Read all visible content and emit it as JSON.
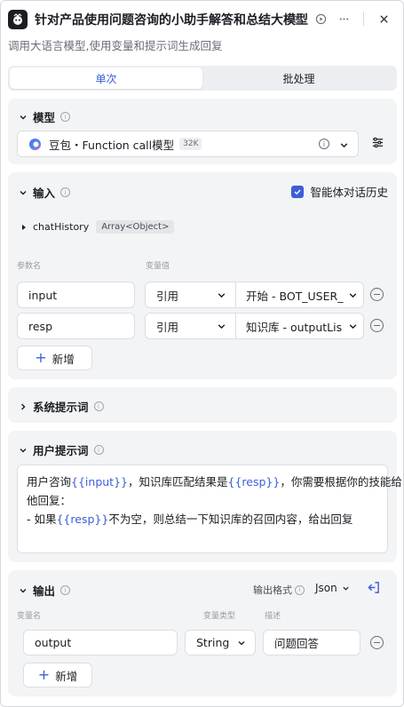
{
  "header": {
    "title": "针对产品使用问题咨询的小助手解答和总结大模型",
    "subtitle": "调用大语言模型,使用变量和提示词生成回复",
    "icons": [
      "bug-off-icon",
      "play-circle-icon",
      "more-icon",
      "close-icon"
    ]
  },
  "tabs": [
    {
      "label": "单次",
      "active": true
    },
    {
      "label": "批处理",
      "active": false
    }
  ],
  "model": {
    "section_title": "模型",
    "model_name": "豆包・Function call模型",
    "badge": "32K"
  },
  "input": {
    "section_title": "输入",
    "chat_history_label": "智能体对话历史",
    "chat_history_checked": true,
    "chat_history_var": "chatHistory",
    "chat_history_type": "Array<Object>",
    "col_param": "参数名",
    "col_value": "变量值",
    "rows": [
      {
        "name": "input",
        "type": "引用",
        "value": "开始 - BOT_USER_"
      },
      {
        "name": "resp",
        "type": "引用",
        "value": "知识库 - outputLis"
      }
    ],
    "add_label": "新增"
  },
  "system_prompt": {
    "section_title": "系统提示词"
  },
  "user_prompt": {
    "section_title": "用户提示词",
    "line1_a": "用户咨询",
    "line1_var1": "{{input}}",
    "line1_b": "，知识库匹配结果是",
    "line1_var2": "{{resp}}",
    "line1_c": "，你需要根据你的技能给",
    "line2": "他回复：",
    "line3_a": "- 如果",
    "line3_var": "{{resp}}",
    "line3_b": "不为空，则总结一下知识库的召回内容，给出回复"
  },
  "output": {
    "section_title": "输出",
    "format_label": "输出格式",
    "format_value": "Json",
    "col_name": "变量名",
    "col_type": "变量类型",
    "col_desc": "描述",
    "rows": [
      {
        "name": "output",
        "type": "String",
        "desc": "问题回答"
      }
    ],
    "add_label": "新增"
  },
  "colors": {
    "accent": "#3b5ed8",
    "card_bg": "#f3f4f6"
  }
}
